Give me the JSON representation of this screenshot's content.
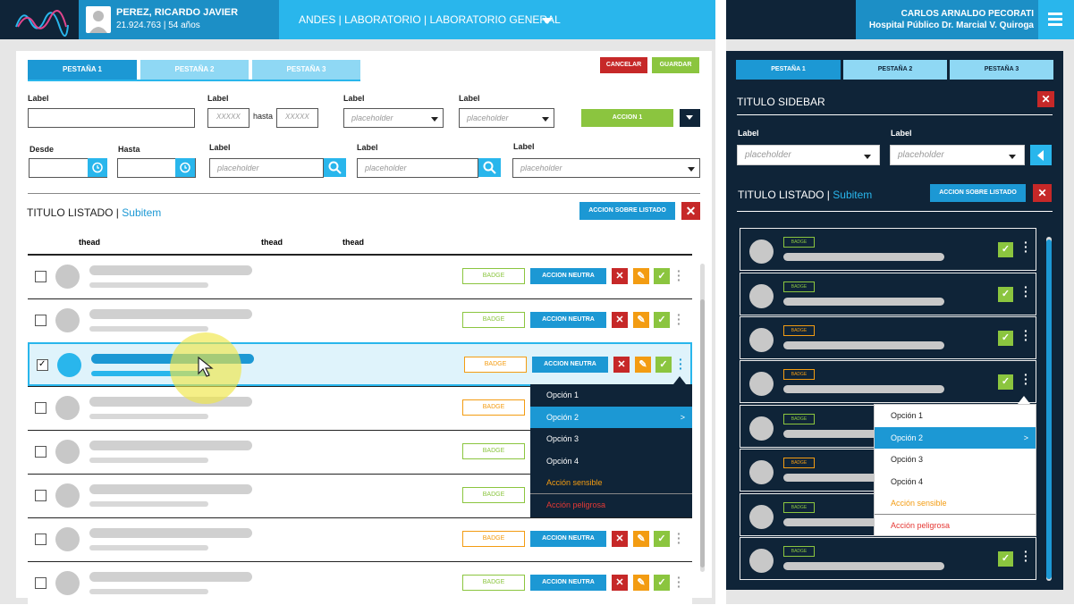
{
  "colors": {
    "accent": "#29b6ec",
    "dark": "#0f2438",
    "danger": "#c62828",
    "success": "#8bc53f",
    "warning": "#f39c12"
  },
  "header": {
    "patient_name": "PEREZ, RICARDO JAVIER",
    "patient_info": "21.924.763 | 54 años",
    "breadcrumb": "ANDES | LABORATORIO | LABORATORIO GENERAL"
  },
  "right_header": {
    "user": "CARLOS ARNALDO PECORATI",
    "hospital": "Hospital Público Dr. Marcial V. Quiroga"
  },
  "tabs": [
    "PESTAÑA 1",
    "PESTAÑA 2",
    "PESTAÑA 3"
  ],
  "actions": {
    "cancel": "CANCELAR",
    "save": "GUARDAR",
    "accion1": "ACCION 1",
    "accion_listado": "ACCION SOBRE LISTADO"
  },
  "filters": {
    "label": "Label",
    "hasta_word": "hasta",
    "range_ph": "XXXXX",
    "placeholder": "placeholder",
    "desde": "Desde",
    "hasta": "Hasta"
  },
  "listado": {
    "title": "TITULO LISTADO",
    "subitem": "Subitem",
    "thead": [
      "thead",
      "thead",
      "thead"
    ]
  },
  "rows": [
    {
      "badge": "BADGE",
      "badge_color": "#8bc53f",
      "action": "ACCION NEUTRA",
      "checked": false
    },
    {
      "badge": "BADGE",
      "badge_color": "#8bc53f",
      "action": "ACCION NEUTRA",
      "checked": false
    },
    {
      "badge": "BADGE",
      "badge_color": "#f39c12",
      "action": "ACCION NEUTRA",
      "checked": true
    },
    {
      "badge": "BADGE",
      "badge_color": "#f39c12",
      "action": "",
      "checked": false
    },
    {
      "badge": "BADGE",
      "badge_color": "#8bc53f",
      "action": "",
      "checked": false
    },
    {
      "badge": "BADGE",
      "badge_color": "#8bc53f",
      "action": "",
      "checked": false
    },
    {
      "badge": "BADGE",
      "badge_color": "#f39c12",
      "action": "ACCION NEUTRA",
      "checked": false
    },
    {
      "badge": "BADGE",
      "badge_color": "#8bc53f",
      "action": "ACCION NEUTRA",
      "checked": false
    }
  ],
  "menu": {
    "items": [
      "Opción 1",
      "Opción 2",
      "Opción 3",
      "Opción 4"
    ],
    "sensible": "Acción sensible",
    "peligrosa": "Acción peligrosa"
  },
  "sidebar": {
    "title": "TITULO SIDEBAR",
    "label": "Label",
    "placeholder": "placeholder",
    "list_title": "TITULO LISTADO",
    "subitem": "Subitem",
    "action": "ACCION SOBRE LISTADO",
    "rows": [
      {
        "badge": "BADGE",
        "badge_color": "#8bc53f"
      },
      {
        "badge": "BADGE",
        "badge_color": "#8bc53f"
      },
      {
        "badge": "BADGE",
        "badge_color": "#f39c12"
      },
      {
        "badge": "BADGE",
        "badge_color": "#f39c12"
      },
      {
        "badge": "BADGE",
        "badge_color": "#8bc53f"
      },
      {
        "badge": "BADGE",
        "badge_color": "#f39c12"
      },
      {
        "badge": "BADGE",
        "badge_color": "#8bc53f"
      },
      {
        "badge": "BADGE",
        "badge_color": "#8bc53f"
      }
    ]
  }
}
